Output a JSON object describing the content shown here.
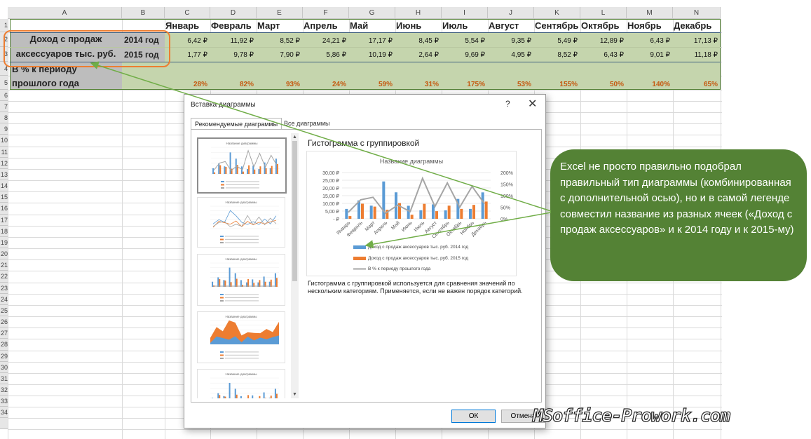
{
  "sheet": {
    "columns": [
      "A",
      "B",
      "C",
      "D",
      "E",
      "F",
      "G",
      "H",
      "I",
      "J",
      "K",
      "L",
      "M",
      "N"
    ],
    "row_numbers": [
      "1",
      "2",
      "3",
      "4",
      "5",
      "6",
      "7",
      "8",
      "9",
      "10",
      "11",
      "12",
      "13",
      "14",
      "15",
      "16",
      "17",
      "18",
      "19",
      "20",
      "21",
      "22",
      "23",
      "24",
      "25",
      "26",
      "27",
      "28",
      "29",
      "30",
      "31",
      "32",
      "33",
      "34"
    ],
    "months": [
      "Январь",
      "Февраль",
      "Март",
      "Апрель",
      "Май",
      "Июнь",
      "Июль",
      "Август",
      "Сентябрь",
      "Октябрь",
      "Ноябрь",
      "Декабрь"
    ],
    "row_label": "Доход с продаж аксессуаров тыс. руб.",
    "row_label_line1": "Доход с продаж",
    "row_label_line2": "аксессуаров тыс. руб.",
    "year_2014": "2014 год",
    "year_2015": "2015 год",
    "values_2014": [
      "6,42 ₽",
      "11,92 ₽",
      "8,52 ₽",
      "24,21 ₽",
      "17,17 ₽",
      "8,45 ₽",
      "5,54 ₽",
      "9,35 ₽",
      "5,49 ₽",
      "12,89 ₽",
      "6,43 ₽",
      "17,13 ₽"
    ],
    "values_2015": [
      "1,77 ₽",
      "9,78 ₽",
      "7,90 ₽",
      "5,86 ₽",
      "10,19 ₽",
      "2,64 ₽",
      "9,69 ₽",
      "4,95 ₽",
      "8,52 ₽",
      "6,43 ₽",
      "9,01 ₽",
      "11,18 ₽"
    ],
    "pct_label_line1": "В % к периоду",
    "pct_label_line2": "прошлого года",
    "pct_values": [
      "28%",
      "82%",
      "93%",
      "24%",
      "59%",
      "31%",
      "175%",
      "53%",
      "155%",
      "50%",
      "140%",
      "65%"
    ]
  },
  "dialog": {
    "title": "Вставка диаграммы",
    "help": "?",
    "close": "✕",
    "tab_recommended": "Рекомендуемые диаграммы",
    "tab_all": "Все диаграммы",
    "preview_title": "Гистограмма с группировкой",
    "description": "Гистограмма с группировкой используется для сравнения значений по нескольким категориям. Применяется, если не важен порядок категорий.",
    "ok": "ОК",
    "cancel": "Отмена",
    "thumb_title": "Название диаграммы"
  },
  "chart_data": {
    "type": "bar",
    "title": "Название диаграммы",
    "categories": [
      "Январь",
      "Февраль",
      "Март",
      "Апрель",
      "Май",
      "Июнь",
      "Июль",
      "Август",
      "Сентябрь",
      "Октябрь",
      "Ноябрь",
      "Декабрь"
    ],
    "series": [
      {
        "name": "Доход с продаж аксессуаров тыс. руб. 2014 год",
        "type": "bar",
        "axis": "left",
        "color": "#5b9bd5",
        "values": [
          6.42,
          11.92,
          8.52,
          24.21,
          17.17,
          8.45,
          5.54,
          9.35,
          5.49,
          12.89,
          6.43,
          17.13
        ]
      },
      {
        "name": "Доход с продаж аксессуаров тыс. руб. 2015 год",
        "type": "bar",
        "axis": "left",
        "color": "#ed7d31",
        "values": [
          1.77,
          9.78,
          7.9,
          5.86,
          10.19,
          2.64,
          9.69,
          4.95,
          8.52,
          6.43,
          9.01,
          11.18
        ]
      },
      {
        "name": "В % к периоду прошлого года",
        "type": "line",
        "axis": "right",
        "color": "#a5a5a5",
        "values": [
          28,
          82,
          93,
          24,
          59,
          31,
          175,
          53,
          155,
          50,
          140,
          65
        ]
      }
    ],
    "y_ticks_left": [
      "30,00 ₽",
      "25,00 ₽",
      "20,00 ₽",
      "15,00 ₽",
      "10,00 ₽",
      "5,00 ₽",
      "-   ₽"
    ],
    "y_ticks_right": [
      "200%",
      "150%",
      "100%",
      "50%",
      "0%"
    ],
    "ylim_left": [
      0,
      30
    ],
    "ylim_right": [
      0,
      200
    ],
    "grid": true,
    "legend_position": "bottom"
  },
  "callout": {
    "text": "Excel не просто правильно подобрал правильный тип диаграммы (комбинированная с дополнительной осью), но и в самой легенде совместил название из разных ячеек («Доход с продаж аксессуаров» и к 2014 году и к 2015-му)",
    "color": "#548235"
  },
  "watermark": "MSoffice-Prowork.com",
  "colors": {
    "highlight_green": "#c5d5ad",
    "orange_frame": "#ed7d31",
    "arrow_green": "#70ad47",
    "bar_2014": "#5b9bd5",
    "bar_2015": "#ed7d31",
    "line_pct": "#a5a5a5"
  }
}
